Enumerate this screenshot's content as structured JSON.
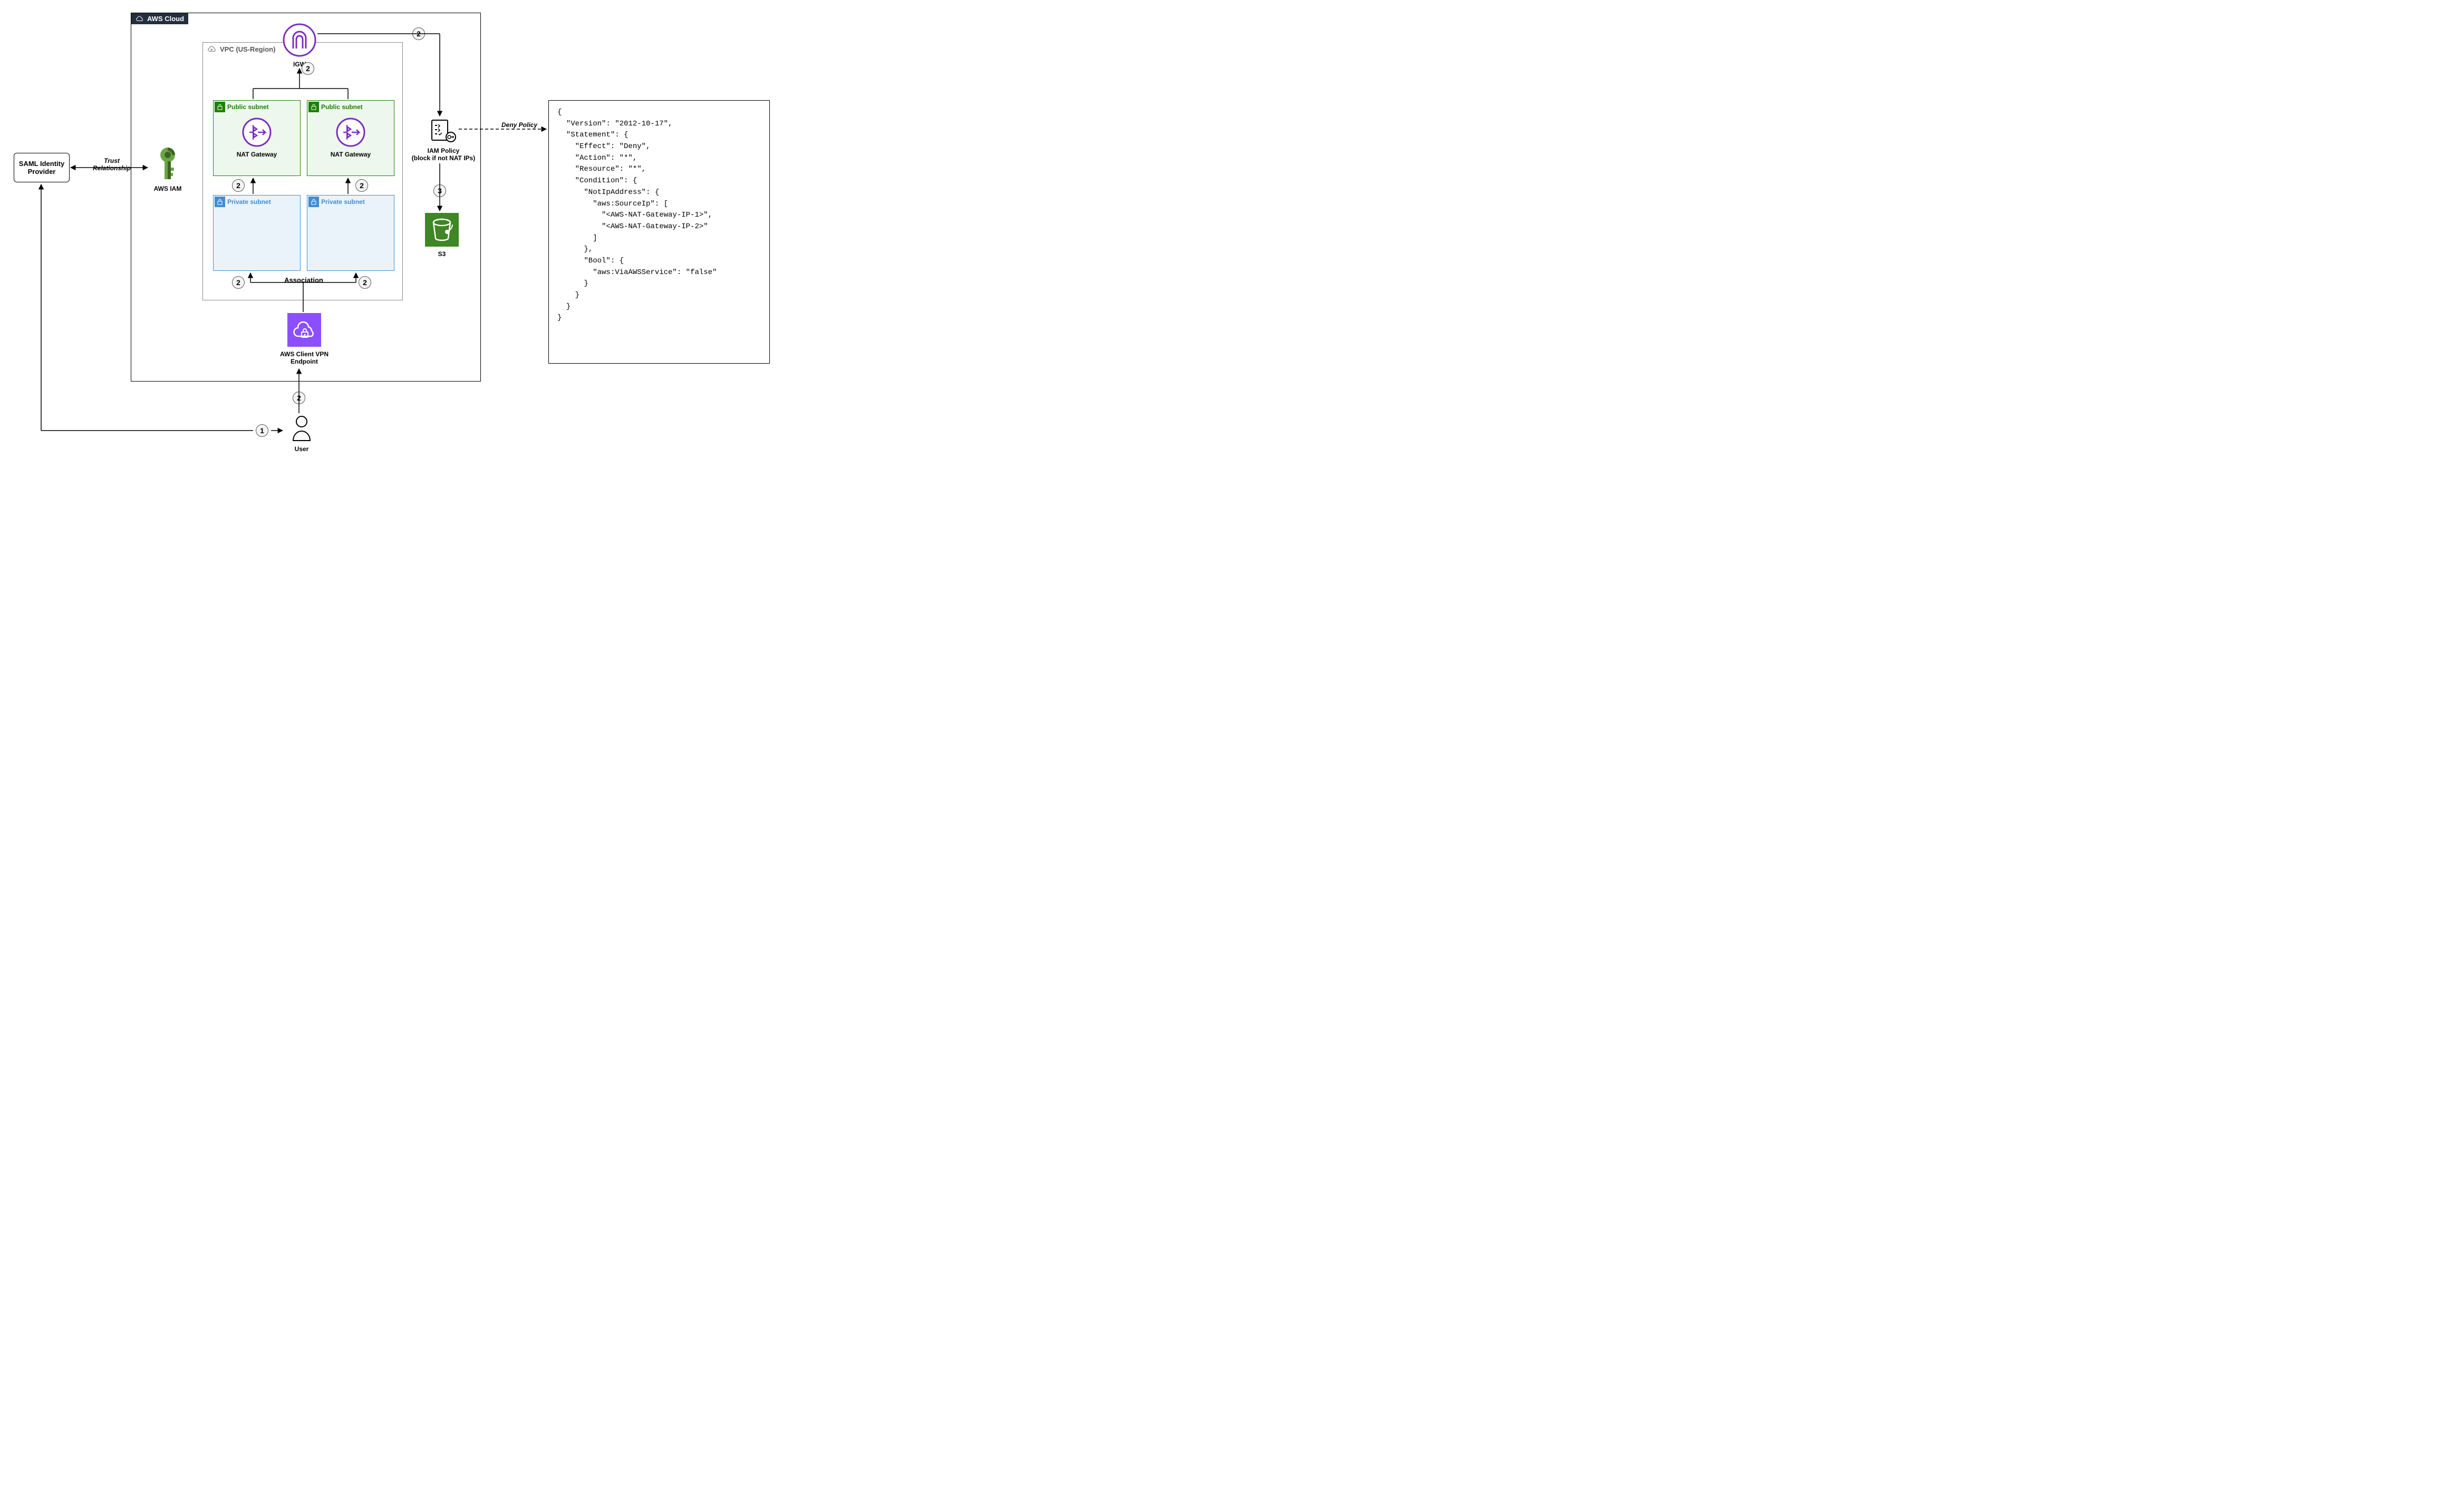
{
  "cloud": {
    "title": "AWS Cloud"
  },
  "vpc": {
    "title": "VPC (US-Region)"
  },
  "saml": {
    "label": "SAML Identity\nProvider"
  },
  "iam": {
    "label": "AWS IAM"
  },
  "trust": {
    "label": "Trust\nRelationship"
  },
  "igw": {
    "label": "IGW"
  },
  "subnets": {
    "public_label": "Public subnet",
    "private_label": "Private subnet",
    "nat_label": "NAT Gateway"
  },
  "association": {
    "label": "Association"
  },
  "vpn": {
    "label": "AWS Client VPN\nEndpoint"
  },
  "user": {
    "label": "User"
  },
  "iam_policy": {
    "label": "IAM Policy\n(block if not NAT IPs)"
  },
  "s3": {
    "label": "S3"
  },
  "deny": {
    "label": "Deny Policy"
  },
  "steps": {
    "s1": "1",
    "s2": "2",
    "s3": "3"
  },
  "policy_json": "{\n  \"Version\": \"2012-10-17\",\n  \"Statement\": {\n    \"Effect\": \"Deny\",\n    \"Action\": \"*\",\n    \"Resource\": \"*\",\n    \"Condition\": {\n      \"NotIpAddress\": {\n        \"aws:SourceIp\": [\n          \"<AWS-NAT-Gateway-IP-1>\",\n          \"<AWS-NAT-Gateway-IP-2>\"\n        ]\n      },\n      \"Bool\": {\n        \"aws:ViaAWSService\": \"false\"\n      }\n    }\n  }\n}"
}
